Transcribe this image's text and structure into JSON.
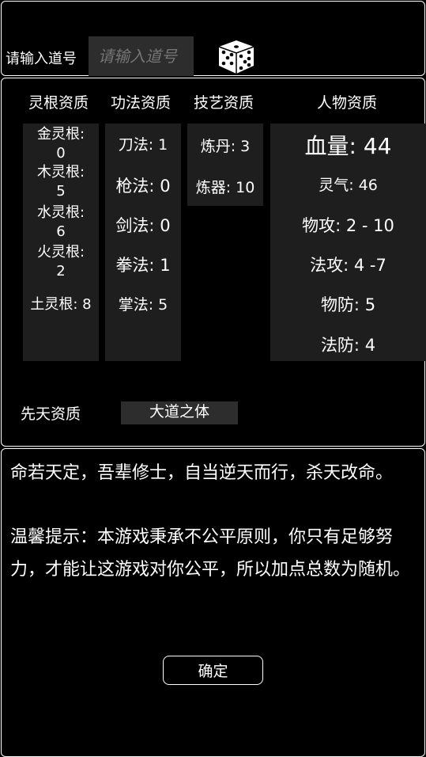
{
  "seed": {
    "label": "请输入道号",
    "placeholder": "请输入道号",
    "value": ""
  },
  "icons": {
    "dice": "dice-icon"
  },
  "stats": {
    "headers": {
      "spirit_root": "灵根资质",
      "technique": "功法资质",
      "craft": "技艺资质",
      "character": "人物资质"
    },
    "spirit_root": {
      "metal": "金灵根:\n0",
      "wood": "木灵根:\n5",
      "water": "水灵根:\n6",
      "fire": "火灵根:\n2",
      "earth": "土灵根: 8"
    },
    "technique": {
      "saber": "刀法: 1",
      "spear": "枪法: 0",
      "sword": "剑法: 0",
      "fist": "拳法: 1",
      "palm": "掌法: 5"
    },
    "craft": {
      "alchemy": "炼丹: 3",
      "forging": "炼器: 10"
    },
    "character": {
      "hp": "血量: 44",
      "qi": "灵气: 46",
      "phys_atk": "物攻: 2 - 10",
      "mag_atk": "法攻: 4 -7",
      "phys_def": "物防: 5",
      "mag_def": "法防: 4"
    },
    "innate": {
      "label": "先天资质",
      "value": "大道之体"
    }
  },
  "story": {
    "line1": "命若天定，吾辈修士，自当逆天而行，杀天改命。",
    "line2": "温馨提示：本游戏秉承不公平原则，你只有足够努力，才能让这游戏对你公平，所以加点总数为随机。"
  },
  "confirm_label": "确定"
}
